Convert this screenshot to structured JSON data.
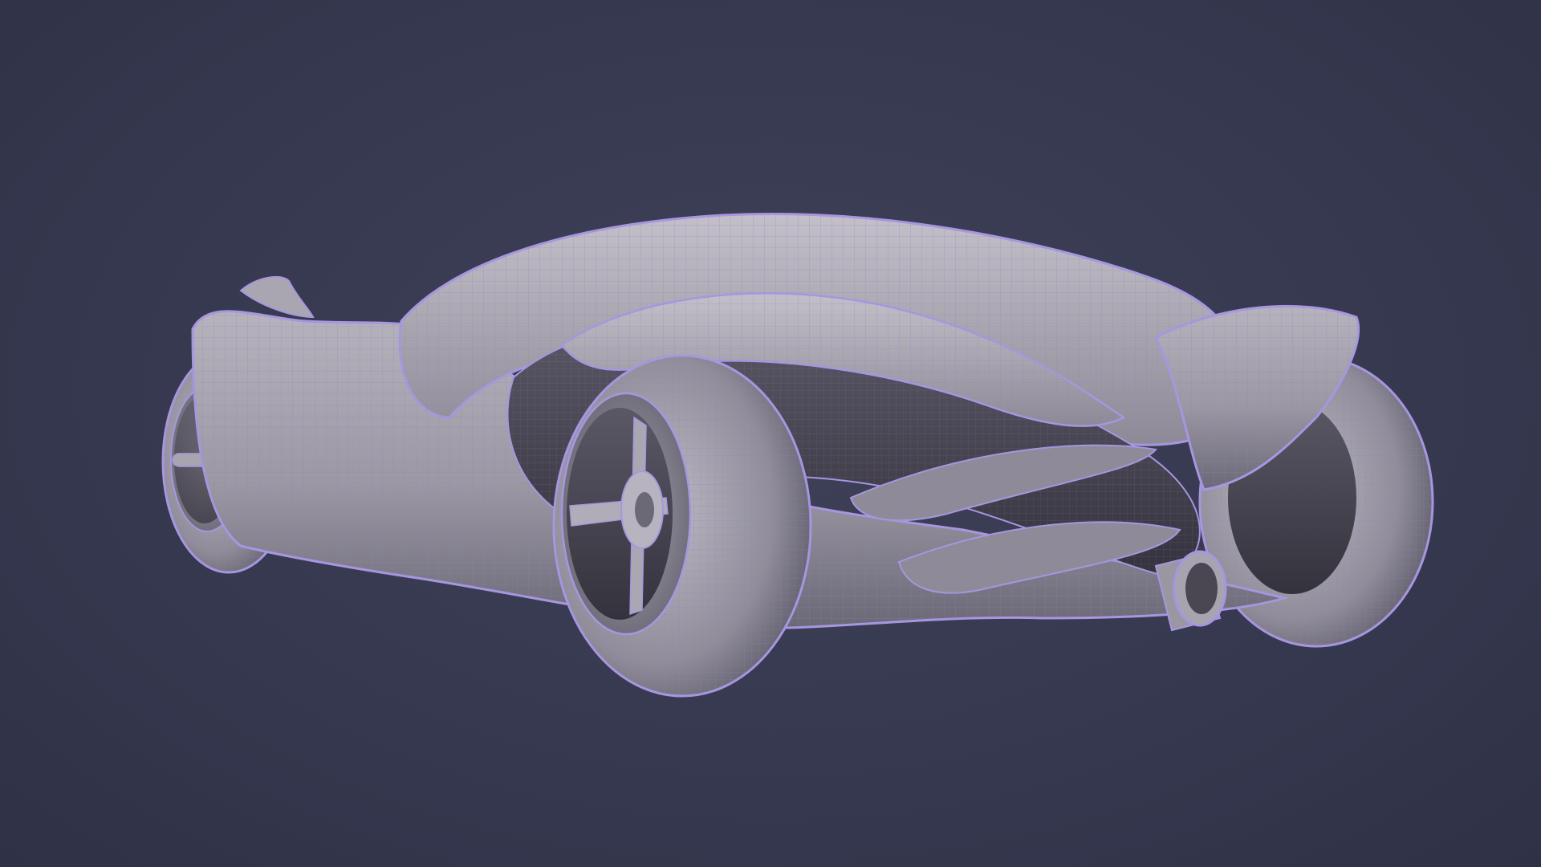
{
  "scene": {
    "subject": "car-wireframe-model",
    "colors": {
      "background": "#363950",
      "surface": "#9a98a2",
      "surface_light": "#bdbbc4",
      "surface_dark": "#5b5866",
      "wire": "#8c80c8",
      "outline": "#a796e0",
      "cavity": "#3a3740"
    }
  }
}
